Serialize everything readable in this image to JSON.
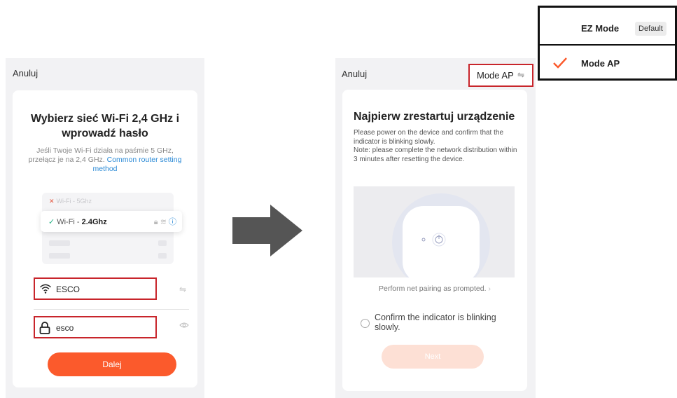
{
  "left": {
    "cancel_label": "Anuluj",
    "title": "Wybierz sieć Wi-Fi 2,4 GHz i wprowadź hasło",
    "description": "Jeśli Twoje Wi-Fi działa na paśmie 5 GHz, przełącz je na 2,4 GHz.",
    "router_link": "Common router setting method",
    "illustration": {
      "wifi5_label": "Wi-Fi - 5Ghz",
      "wifi24_prefix": "Wi-Fi - ",
      "wifi24_band": "2.4Ghz"
    },
    "ssid_value": "ESCO",
    "password_value": "esco",
    "next_label": "Dalej"
  },
  "right": {
    "cancel_label": "Anuluj",
    "mode_label": "Mode AP",
    "title": "Najpierw zrestartuj urządzenie",
    "description": "Please power on the device and confirm that the indicator is blinking slowly.\nNote: please complete the network distribution within 3 minutes after resetting the device.",
    "net_pairing_link": "Perform net pairing as prompted.",
    "confirm_label": "Confirm the indicator is blinking slowly.",
    "next_label": "Next"
  },
  "mode_dropdown": {
    "options": [
      {
        "label": "EZ Mode",
        "badge": "Default",
        "selected": false
      },
      {
        "label": "Mode AP",
        "badge": "",
        "selected": true
      }
    ]
  },
  "colors": {
    "accent": "#fb5a2c",
    "highlight_box": "#c8252b",
    "link": "#2b8ad6",
    "check": "#27b186"
  },
  "icons": {
    "ssid": "wifi-icon",
    "password": "lock-icon",
    "switch_network": "switch-arrows-icon",
    "show_password": "eye-icon",
    "flow": "right-arrow-icon",
    "selected_option": "checkmark-icon"
  }
}
